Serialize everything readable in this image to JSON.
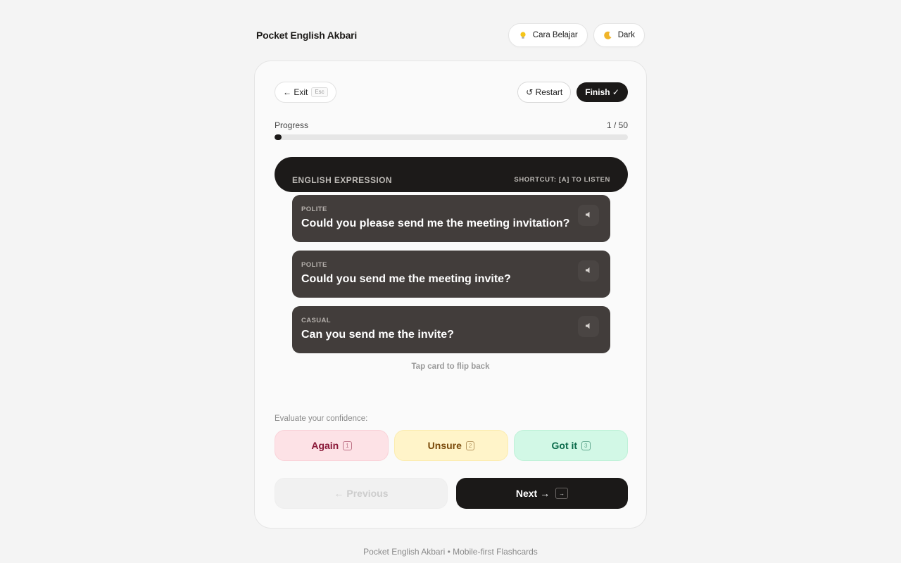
{
  "header": {
    "title": "Pocket English Akbari",
    "guide_label": "Cara Belajar",
    "theme_label": "Dark"
  },
  "toolbar": {
    "exit_label": "← Exit",
    "exit_key": "Esc",
    "restart_label": "↺ Restart",
    "finish_label": "Finish ✓"
  },
  "progress": {
    "label": "Progress",
    "current": 1,
    "total": 50,
    "text": "1 / 50"
  },
  "card": {
    "label": "ENGLISH EXPRESSION",
    "shortcut": "SHORTCUT: [A] TO LISTEN",
    "expressions": [
      {
        "tag": "POLITE",
        "text": "Could you please send me the meeting invitation?"
      },
      {
        "tag": "POLITE",
        "text": "Could you send me the meeting invite?"
      },
      {
        "tag": "CASUAL",
        "text": "Can you send me the invite?"
      }
    ],
    "flip_hint": "Tap card to flip back"
  },
  "evaluate": {
    "label": "Evaluate your confidence:",
    "options": [
      {
        "label": "Again",
        "key": "1"
      },
      {
        "label": "Unsure",
        "key": "2"
      },
      {
        "label": "Got it",
        "key": "3"
      }
    ]
  },
  "nav": {
    "previous_label": "← Previous",
    "next_label": "Next →",
    "next_key": "→"
  },
  "footer": {
    "text": "Pocket English Akbari • Mobile-first Flashcards"
  },
  "colors": {
    "accent_dark": "#1b1918",
    "again_bg": "#fde2e6",
    "unsure_bg": "#fff4c9",
    "got_bg": "#d2f8e6"
  },
  "icons": {
    "guide": "lightbulb-icon",
    "theme": "moon-icon",
    "speak": "speaker-icon"
  }
}
